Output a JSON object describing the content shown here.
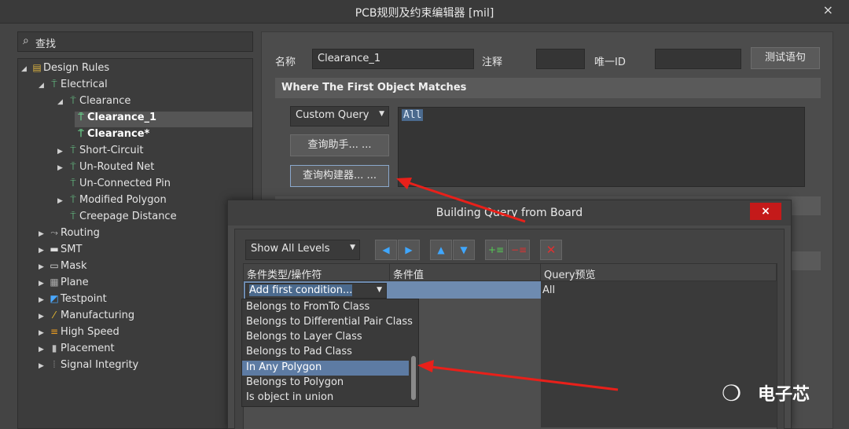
{
  "window": {
    "title": "PCB规则及约束编辑器 [mil]",
    "close_glyph": "×"
  },
  "search": {
    "icon": "search-icon",
    "text": "查找"
  },
  "tree": [
    {
      "label": "Design Rules",
      "level": 0,
      "expanded": true,
      "icon": "rules-folder-icon"
    },
    {
      "label": "Electrical",
      "level": 1,
      "expanded": true,
      "icon": "rule-icon"
    },
    {
      "label": "Clearance",
      "level": 2,
      "expanded": true,
      "icon": "rule-icon"
    },
    {
      "label": "Clearance_1",
      "level": 3,
      "bold": true,
      "selected": true,
      "icon": "rule-item-icon"
    },
    {
      "label": "Clearance*",
      "level": 3,
      "bold": true,
      "icon": "rule-item-icon"
    },
    {
      "label": "Short-Circuit",
      "level": 2,
      "collapsed": true,
      "icon": "rule-icon"
    },
    {
      "label": "Un-Routed Net",
      "level": 2,
      "collapsed": true,
      "icon": "rule-icon"
    },
    {
      "label": "Un-Connected Pin",
      "level": 2,
      "icon": "rule-icon"
    },
    {
      "label": "Modified Polygon",
      "level": 2,
      "collapsed": true,
      "icon": "rule-icon"
    },
    {
      "label": "Creepage Distance",
      "level": 2,
      "icon": "rule-icon"
    },
    {
      "label": "Routing",
      "level": 1,
      "collapsed": true,
      "icon": "routing-icon"
    },
    {
      "label": "SMT",
      "level": 1,
      "collapsed": true,
      "icon": "smt-icon"
    },
    {
      "label": "Mask",
      "level": 1,
      "collapsed": true,
      "icon": "mask-icon"
    },
    {
      "label": "Plane",
      "level": 1,
      "collapsed": true,
      "icon": "plane-icon"
    },
    {
      "label": "Testpoint",
      "level": 1,
      "collapsed": true,
      "icon": "testpoint-icon"
    },
    {
      "label": "Manufacturing",
      "level": 1,
      "collapsed": true,
      "icon": "manufacturing-icon"
    },
    {
      "label": "High Speed",
      "level": 1,
      "collapsed": true,
      "icon": "high-speed-icon"
    },
    {
      "label": "Placement",
      "level": 1,
      "collapsed": true,
      "icon": "placement-icon"
    },
    {
      "label": "Signal Integrity",
      "level": 1,
      "collapsed": true,
      "icon": "signal-integrity-icon"
    }
  ],
  "editor": {
    "name_label": "名称",
    "name_value": "Clearance_1",
    "comment_label": "注释",
    "comment_value": "",
    "uid_label": "唯一ID",
    "uid_value": "",
    "test_button": "测试语句",
    "section_title": "Where The First Object Matches",
    "query_type": "Custom Query",
    "query_helper_button": "查询助手... ...",
    "query_builder_button": "查询构建器... ...",
    "query_text": "All"
  },
  "dialog": {
    "title": "Building Query from Board",
    "close_glyph": "×",
    "level_select": "Show All Levels",
    "toolbar_icons": [
      "arrow-left-icon",
      "arrow-right-icon",
      "arrow-up-icon",
      "arrow-down-icon",
      "add-condition-icon",
      "remove-condition-icon",
      "delete-icon"
    ],
    "columns": [
      "条件类型/操作符",
      "条件值",
      "Query预览"
    ],
    "condition_placeholder": "Add first condition...",
    "preview_text": "All",
    "dropdown_items": [
      "Belongs to FromTo Class",
      "Belongs to Differential Pair Class",
      "Belongs to Layer Class",
      "Belongs to Pad Class",
      "In Any Polygon",
      "Belongs to Polygon",
      "Is object in union"
    ],
    "dropdown_selected_index": 4
  },
  "watermark": {
    "icon": "wechat-icon",
    "text": "电子芯"
  },
  "colors": {
    "annotation_arrow": "#e8201a",
    "selection": "#5d7ba3",
    "close_red": "#c41a1a"
  }
}
